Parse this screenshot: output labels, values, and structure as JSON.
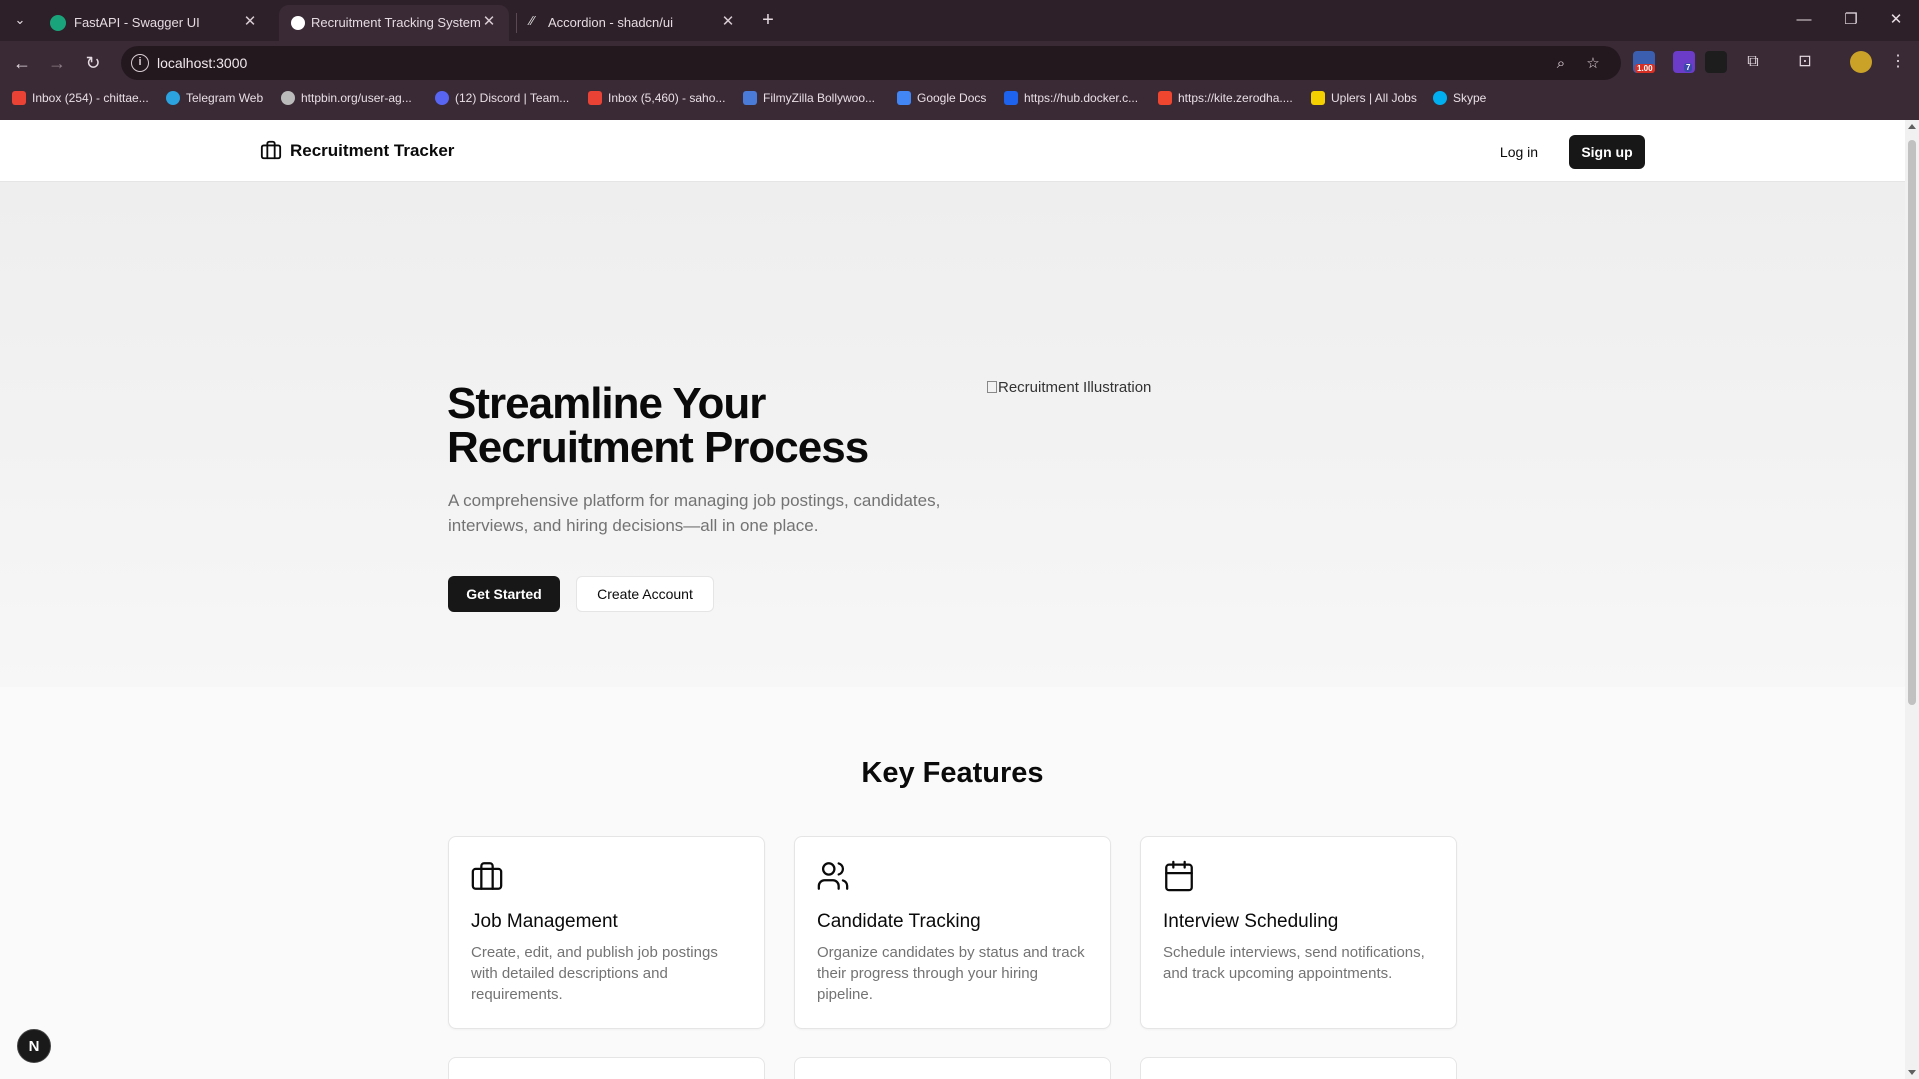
{
  "browser": {
    "tabs": [
      {
        "title": "FastAPI - Swagger UI",
        "active": false,
        "favicon_color": "#1aa47c"
      },
      {
        "title": "Recruitment Tracking System",
        "active": true,
        "favicon_color": "#ffffff"
      },
      {
        "title": "Accordion - shadcn/ui",
        "active": false,
        "favicon_color": "#dddddd"
      }
    ],
    "url": "localhost:3000",
    "bookmarks": [
      {
        "label": "Inbox (254) - chittae...",
        "icon": "gmail-icon",
        "color": "#ea4335"
      },
      {
        "label": "Telegram Web",
        "icon": "telegram-icon",
        "color": "#2aa3df"
      },
      {
        "label": "httpbin.org/user-ag...",
        "icon": "globe-icon",
        "color": "#bbbbbb"
      },
      {
        "label": "(12) Discord | Team...",
        "icon": "discord-icon",
        "color": "#5865f2"
      },
      {
        "label": "Inbox (5,460) - saho...",
        "icon": "gmail-icon",
        "color": "#ea4335"
      },
      {
        "label": "FilmyZilla Bollywoo...",
        "icon": "filmyzilla-icon",
        "color": "#4a7bd8"
      },
      {
        "label": "Google Docs",
        "icon": "docs-icon",
        "color": "#4285f4"
      },
      {
        "label": "https://hub.docker.c...",
        "icon": "docker-icon",
        "color": "#1d63ed"
      },
      {
        "label": "https://kite.zerodha....",
        "icon": "kite-icon",
        "color": "#f0452e"
      },
      {
        "label": "Uplers | All Jobs",
        "icon": "uplers-icon",
        "color": "#f5d000"
      },
      {
        "label": "Skype",
        "icon": "skype-icon",
        "color": "#00aff0"
      }
    ],
    "extension_badges": {
      "first": "1.00",
      "second": "7"
    }
  },
  "header": {
    "brand": "Recruitment Tracker",
    "login": "Log in",
    "signup": "Sign up"
  },
  "hero": {
    "image_alt": "Recruitment Illustration",
    "title": "Streamline Your Recruitment Process",
    "subtitle": "A comprehensive platform for managing job postings, candidates, interviews, and hiring decisions—all in one place.",
    "primary_cta": "Get Started",
    "secondary_cta": "Create Account"
  },
  "features": {
    "title": "Key Features",
    "items": [
      {
        "title": "Job Management",
        "description": "Create, edit, and publish job postings with detailed descriptions and requirements.",
        "icon": "briefcase-icon"
      },
      {
        "title": "Candidate Tracking",
        "description": "Organize candidates by status and track their progress through your hiring pipeline.",
        "icon": "users-icon"
      },
      {
        "title": "Interview Scheduling",
        "description": "Schedule interviews, send notifications, and track upcoming appointments.",
        "icon": "calendar-icon"
      }
    ]
  },
  "dev_badge": "N",
  "colors": {
    "primary": "#171717",
    "muted_text": "#737373",
    "border": "#e5e5e5",
    "chrome": "#3a2a36"
  }
}
